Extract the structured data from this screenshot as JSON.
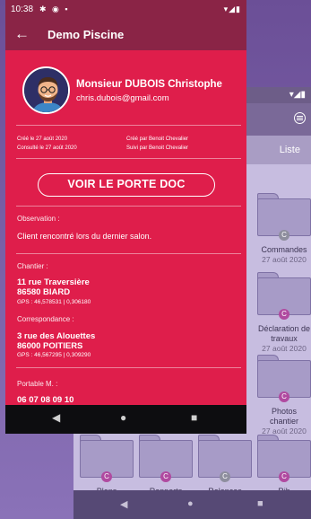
{
  "background_app": {
    "tab_label": "Liste",
    "folders": [
      {
        "title": "Commandes",
        "date": "27 août 2020"
      },
      {
        "title": "Déclaration de travaux",
        "date": "27 août 2020"
      },
      {
        "title": "Photos chantier",
        "date": "27 août 2020"
      },
      {
        "title": "Plans",
        "date": ""
      },
      {
        "title": "Rapports",
        "date": ""
      },
      {
        "title": "Relances",
        "date": ""
      },
      {
        "title": "Rib",
        "date": ""
      }
    ]
  },
  "status_bar": {
    "time": "10:38"
  },
  "app_bar": {
    "title": "Demo Piscine"
  },
  "profile": {
    "name": "Monsieur DUBOIS Christophe",
    "email": "chris.dubois@gmail.com"
  },
  "meta": {
    "created": "Créé le 27 août 2020",
    "consulted": "Consulté le 27 août 2020",
    "created_by": "Créé par Benoit Chevalier",
    "followed_by": "Suivi par Benoit Chevalier"
  },
  "doc_button": "VOIR LE PORTE DOC",
  "observation": {
    "label": "Observation :",
    "text": "Client rencontré lors du dernier salon."
  },
  "chantier": {
    "label": "Chantier :",
    "street": "11 rue Traversière",
    "city": "86580 BIARD",
    "gps": "GPS : 46,578531 | 0,306180"
  },
  "correspondance": {
    "label": "Correspondance :",
    "street": "3 rue des Alouettes",
    "city": "86000 POITIERS",
    "gps": "GPS : 46,567295 | 0,309290"
  },
  "portable": {
    "label": "Portable M. :",
    "number": "06 07 08 09 10"
  },
  "colors": {
    "primary": "#DF1E4B",
    "app_bar": "#8A2446",
    "nav_bar": "#0D0D10"
  },
  "icons": {
    "back": "arrow-left-icon",
    "nav_back": "triangle-left-icon",
    "nav_home": "circle-icon",
    "nav_recents": "square-icon"
  }
}
